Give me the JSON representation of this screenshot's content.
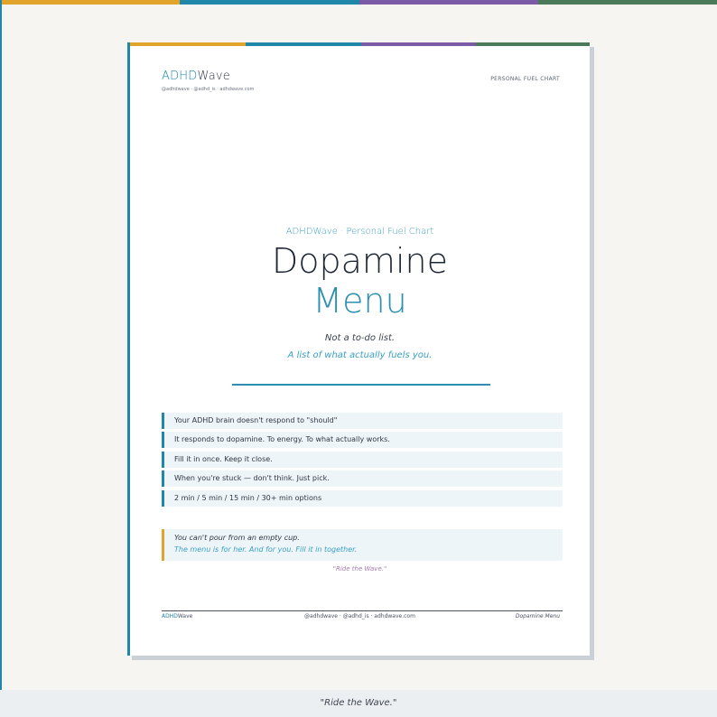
{
  "colors": {
    "blue": "#1f87a8",
    "teal": "#2b97a3",
    "purple": "#7b5aa6",
    "green": "#4a7a57",
    "amber": "#e1a32a",
    "page_bg": "#f6f5f1"
  },
  "header": {
    "brand_part1": "ADHD",
    "brand_part2": "Wave",
    "brand_handles": "@adhdwave · @adhd_is · adhdwave.com",
    "doc_label": "PERSONAL FUEL CHART"
  },
  "title_block": {
    "kicker": "ADHDWave · Personal Fuel Chart",
    "title_line1": "Dopamine",
    "title_line2": "Menu",
    "subtitle1": "Not a to-do list.",
    "subtitle2": "A list of what actually fuels you."
  },
  "points": [
    "Your ADHD brain doesn't respond to \"should\"",
    "It responds to dopamine. To energy. To what actually works.",
    "Fill it in once. Keep it close.",
    "When you're stuck — don't think. Just pick.",
    "2 min / 5 min / 15 min / 30+ min options"
  ],
  "note": {
    "line1": "You can't pour from an empty cup.",
    "line2": "The menu is for her. And for you. Fill it in together."
  },
  "tagline": "\"Ride the Wave.\"",
  "footer": {
    "brand_part1": "ADHD",
    "brand_part2": "Wave",
    "handles": "@adhdwave · @adhd_is · adhdwave.com",
    "doc_name": "Dopamine Menu"
  },
  "bottom_tagline": "\"Ride the Wave.\""
}
